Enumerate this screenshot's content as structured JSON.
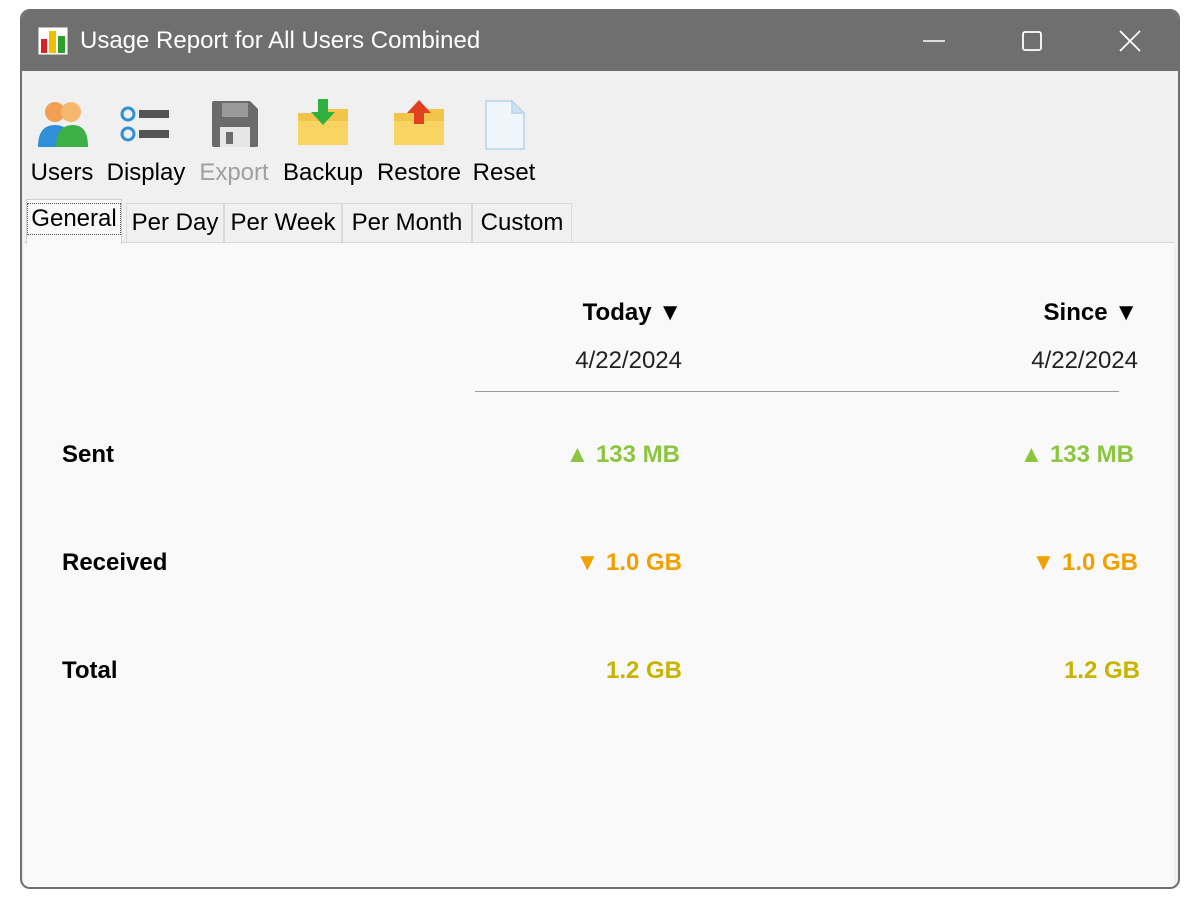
{
  "window": {
    "title": "Usage Report for All Users Combined"
  },
  "toolbar": {
    "items": [
      {
        "label": "Users",
        "icon": "users-icon",
        "enabled": true
      },
      {
        "label": "Display",
        "icon": "display-list-icon",
        "enabled": true
      },
      {
        "label": "Export",
        "icon": "floppy-disk-icon",
        "enabled": false
      },
      {
        "label": "Backup",
        "icon": "folder-download-icon",
        "enabled": true
      },
      {
        "label": "Restore",
        "icon": "folder-upload-icon",
        "enabled": true
      },
      {
        "label": "Reset",
        "icon": "blank-document-icon",
        "enabled": true
      }
    ]
  },
  "tabs": [
    {
      "label": "General",
      "active": true
    },
    {
      "label": "Per Day",
      "active": false
    },
    {
      "label": "Per Week",
      "active": false
    },
    {
      "label": "Per Month",
      "active": false
    },
    {
      "label": "Custom",
      "active": false
    }
  ],
  "columns": {
    "today": {
      "label": "Today ▼",
      "date": "4/22/2024"
    },
    "since": {
      "label": "Since ▼",
      "date": "4/22/2024"
    }
  },
  "rows": {
    "sent": {
      "label": "Sent",
      "today": "▲ 133 MB",
      "since": "▲ 133 MB"
    },
    "received": {
      "label": "Received",
      "today": "▼ 1.0 GB",
      "since": "▼ 1.0 GB"
    },
    "total": {
      "label": "Total",
      "today": "1.2 GB",
      "since": "1.2 GB"
    }
  },
  "colors": {
    "sent": "#8cc63f",
    "received": "#f0a000",
    "total": "#c8b400",
    "titlebar": "#6f6f6f"
  }
}
